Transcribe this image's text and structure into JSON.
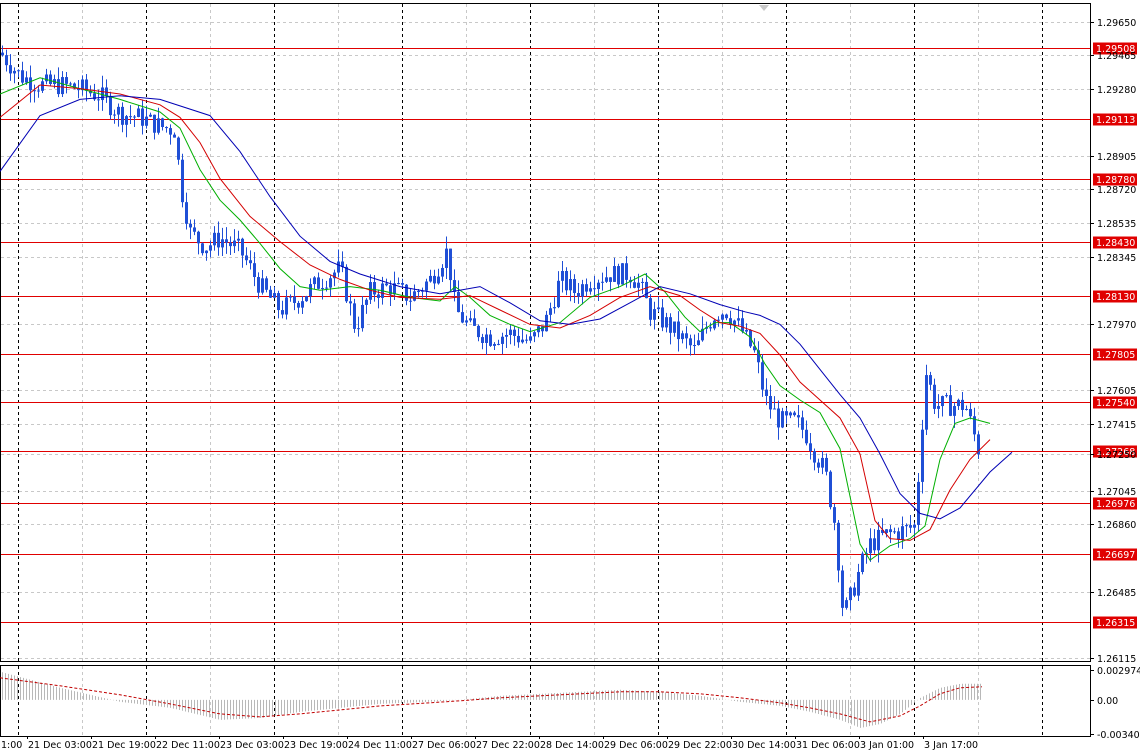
{
  "chart_data": [
    {
      "type": "candlestick",
      "title": "",
      "ylim": [
        1.261,
        1.2975
      ],
      "grid": true,
      "y_ticks": [
        "1.29650",
        "1.29465",
        "1.29280",
        "1.28905",
        "1.28720",
        "1.28535",
        "1.28345",
        "1.27970",
        "1.27605",
        "1.27415",
        "1.27250",
        "1.27045",
        "1.26860",
        "1.26485",
        "1.26115"
      ],
      "x_ticks": [
        "21 Dec 03:00",
        "21 Dec 19:00",
        "22 Dec 11:00",
        "23 Dec 03:00",
        "23 Dec 19:00",
        "24 Dec 11:00",
        "27 Dec 06:00",
        "27 Dec 22:00",
        "28 Dec 14:00",
        "29 Dec 06:00",
        "29 Dec 22:00",
        "30 Dec 14:00",
        "31 Dec 06:00",
        "3 Jan 01:00",
        "3 Jan 17:00"
      ],
      "x_ticks_truncated": [
        "1:00"
      ],
      "levels": {
        "names": [
          "1.29508",
          "1.29113",
          "1.28780",
          "1.28430",
          "1.28130",
          "1.27805",
          "1.27540",
          "1.27268",
          "1.26976",
          "1.26697",
          "1.26315"
        ],
        "values": [
          1.29508,
          1.29113,
          1.2878,
          1.2843,
          1.2813,
          1.27805,
          1.2754,
          1.27268,
          1.26976,
          1.26697,
          1.26315
        ]
      },
      "level_color": "#e00000",
      "candle_color": "#1f4fd6",
      "price_path": {
        "x": [
          0,
          20,
          40,
          60,
          80,
          100,
          120,
          140,
          160,
          175,
          180,
          190,
          205,
          220,
          240,
          260,
          280,
          300,
          320,
          340,
          355,
          370,
          390,
          410,
          430,
          447,
          455,
          470,
          490,
          510,
          530,
          545,
          560,
          575,
          590,
          610,
          630,
          640,
          650,
          665,
          680,
          695,
          705,
          715,
          725,
          740,
          755,
          765,
          780,
          795,
          805,
          815,
          825,
          835,
          843,
          852,
          860,
          870,
          885,
          900,
          915,
          920,
          926,
          935,
          950,
          965,
          978
        ],
        "y": [
          1.2948,
          1.2935,
          1.293,
          1.293,
          1.2928,
          1.2924,
          1.2914,
          1.2912,
          1.2907,
          1.2905,
          1.2875,
          1.2848,
          1.284,
          1.2845,
          1.2838,
          1.2818,
          1.2805,
          1.2812,
          1.2821,
          1.2828,
          1.2795,
          1.2815,
          1.2818,
          1.2812,
          1.2822,
          1.2838,
          1.2805,
          1.2795,
          1.279,
          1.2792,
          1.2787,
          1.2798,
          1.2822,
          1.2815,
          1.2822,
          1.2825,
          1.2825,
          1.2818,
          1.2804,
          1.2798,
          1.279,
          1.2782,
          1.2795,
          1.2803,
          1.2805,
          1.2795,
          1.278,
          1.2755,
          1.2743,
          1.2743,
          1.2737,
          1.2725,
          1.2715,
          1.2685,
          1.2635,
          1.2648,
          1.2662,
          1.2675,
          1.268,
          1.2682,
          1.2685,
          1.273,
          1.277,
          1.2752,
          1.2752,
          1.2752,
          1.2728
        ]
      },
      "series": [
        {
          "color": "#00b000",
          "x": [
            0,
            40,
            80,
            120,
            160,
            180,
            200,
            220,
            240,
            260,
            280,
            300,
            320,
            350,
            380,
            410,
            440,
            455,
            470,
            490,
            510,
            530,
            560,
            590,
            620,
            645,
            665,
            685,
            700,
            715,
            730,
            750,
            765,
            780,
            800,
            820,
            840,
            860,
            870,
            890,
            910,
            925,
            940,
            955,
            970,
            990
          ],
          "y": [
            1.2925,
            1.2934,
            1.2928,
            1.2922,
            1.2915,
            1.2906,
            1.2883,
            1.2866,
            1.2855,
            1.2842,
            1.2828,
            1.2818,
            1.2816,
            1.2818,
            1.2816,
            1.2812,
            1.281,
            1.2818,
            1.2812,
            1.2802,
            1.2797,
            1.2793,
            1.2798,
            1.2812,
            1.2818,
            1.2825,
            1.2815,
            1.2801,
            1.2793,
            1.2798,
            1.2798,
            1.279,
            1.2775,
            1.2763,
            1.2755,
            1.2748,
            1.2728,
            1.2675,
            1.2666,
            1.2674,
            1.2678,
            1.2685,
            1.2722,
            1.2742,
            1.2745,
            1.2742
          ]
        },
        {
          "color": "#d40000",
          "x": [
            0,
            40,
            80,
            120,
            160,
            180,
            200,
            220,
            250,
            280,
            310,
            340,
            370,
            400,
            440,
            470,
            500,
            530,
            560,
            590,
            620,
            650,
            680,
            700,
            720,
            740,
            760,
            780,
            800,
            820,
            840,
            860,
            875,
            890,
            910,
            930,
            950,
            970,
            990
          ],
          "y": [
            1.2912,
            1.293,
            1.2928,
            1.2925,
            1.2919,
            1.2912,
            1.2898,
            1.2878,
            1.2857,
            1.2843,
            1.283,
            1.2822,
            1.2816,
            1.2812,
            1.2811,
            1.2813,
            1.2805,
            1.2797,
            1.2795,
            1.2802,
            1.2812,
            1.2818,
            1.2813,
            1.2805,
            1.2798,
            1.2796,
            1.2792,
            1.278,
            1.2765,
            1.2755,
            1.2745,
            1.2725,
            1.2688,
            1.2678,
            1.2677,
            1.2683,
            1.2705,
            1.2722,
            1.2733
          ]
        },
        {
          "color": "#0000b4",
          "x": [
            0,
            40,
            80,
            120,
            160,
            210,
            240,
            270,
            300,
            330,
            360,
            400,
            440,
            480,
            510,
            540,
            570,
            600,
            630,
            660,
            690,
            720,
            745,
            760,
            780,
            800,
            820,
            840,
            860,
            880,
            900,
            920,
            940,
            960,
            990,
            1012
          ],
          "y": [
            1.2882,
            1.2913,
            1.2922,
            1.2924,
            1.2922,
            1.2913,
            1.2893,
            1.2868,
            1.2846,
            1.2832,
            1.2825,
            1.2818,
            1.2814,
            1.2818,
            1.2809,
            1.2799,
            1.2797,
            1.28,
            1.2809,
            1.2818,
            1.2814,
            1.2808,
            1.2804,
            1.2802,
            1.2797,
            1.2786,
            1.2772,
            1.2758,
            1.2745,
            1.2725,
            1.2703,
            1.2692,
            1.2689,
            1.2695,
            1.2715,
            1.2726
          ]
        }
      ]
    },
    {
      "type": "histogram",
      "title": "",
      "ylim": [
        -0.003405,
        0.002974
      ],
      "y_ticks": [
        "0.002974",
        "0.00",
        "-0.003405"
      ],
      "bar_color": "#b8b8b8",
      "signal_color": "#c00000",
      "histogram": {
        "x": [
          0,
          60,
          120,
          170,
          220,
          260,
          300,
          340,
          380,
          430,
          460,
          500,
          540,
          580,
          620,
          660,
          700,
          740,
          780,
          810,
          840,
          860,
          880,
          900,
          920,
          940,
          960,
          982
        ],
        "y": [
          0.0028,
          0.0012,
          -0.0002,
          -0.0008,
          -0.002,
          -0.0018,
          -0.0012,
          -0.0008,
          -0.0004,
          -0.0002,
          0.0,
          0.0004,
          0.0006,
          0.0008,
          0.001,
          0.0008,
          0.0004,
          -0.0002,
          -0.0006,
          -0.0012,
          -0.002,
          -0.0028,
          -0.0024,
          -0.0014,
          0.0002,
          0.0012,
          0.0016,
          0.0016
        ]
      },
      "signal": {
        "x": [
          0,
          60,
          120,
          170,
          220,
          260,
          300,
          340,
          380,
          430,
          460,
          500,
          540,
          580,
          620,
          660,
          700,
          740,
          780,
          810,
          840,
          870,
          900,
          920,
          940,
          960,
          982
        ],
        "y": [
          0.0022,
          0.0014,
          0.0005,
          -0.0004,
          -0.0014,
          -0.0017,
          -0.0014,
          -0.001,
          -0.0006,
          -0.0003,
          -0.0001,
          0.0002,
          0.0004,
          0.0006,
          0.0008,
          0.0008,
          0.0006,
          0.0002,
          -0.0003,
          -0.0008,
          -0.0014,
          -0.0022,
          -0.0016,
          -0.0006,
          0.0006,
          0.0012,
          0.0013
        ]
      }
    }
  ]
}
